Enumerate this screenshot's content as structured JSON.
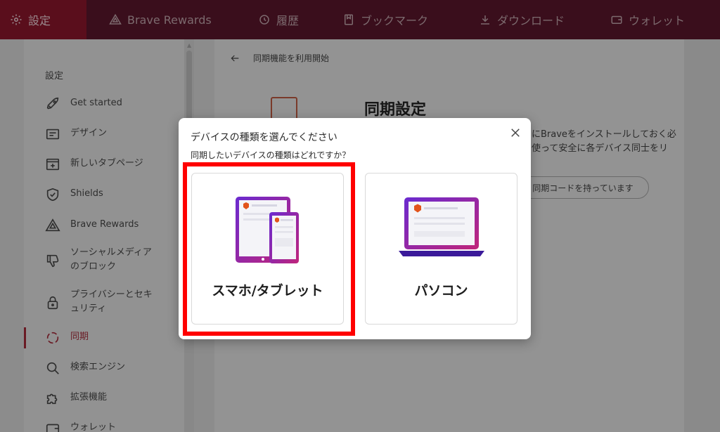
{
  "topnav": {
    "items": [
      {
        "label": "設定",
        "icon": "gear-icon",
        "active": true
      },
      {
        "label": "Brave Rewards",
        "icon": "triangle-icon",
        "active": false
      },
      {
        "label": "履歴",
        "icon": "history-icon",
        "active": false
      },
      {
        "label": "ブックマーク",
        "icon": "bookmark-icon",
        "active": false
      },
      {
        "label": "ダウンロード",
        "icon": "download-icon",
        "active": false
      },
      {
        "label": "ウォレット",
        "icon": "wallet-icon",
        "active": false
      }
    ]
  },
  "sidebar": {
    "title": "設定",
    "items": [
      {
        "label": "Get started",
        "icon": "rocket-icon"
      },
      {
        "label": "デザイン",
        "icon": "appearance-icon"
      },
      {
        "label": "新しいタブページ",
        "icon": "new-tab-icon"
      },
      {
        "label": "Shields",
        "icon": "shield-icon"
      },
      {
        "label": "Brave Rewards",
        "icon": "rewards-icon"
      },
      {
        "label": "ソーシャルメディアのブロック",
        "label_line1": "ソーシャルメディア",
        "label_line2": "のブロック",
        "icon": "thumbs-down-icon"
      },
      {
        "label": "プライバシーとセキュリティ",
        "label_line1": "プライバシーとセキ",
        "label_line2": "ュリティ",
        "icon": "lock-icon"
      },
      {
        "label": "同期",
        "icon": "sync-icon",
        "active": true
      },
      {
        "label": "検索エンジン",
        "icon": "search-icon"
      },
      {
        "label": "拡張機能",
        "icon": "puzzle-icon"
      },
      {
        "label": "ウォレット",
        "icon": "wallet-icon"
      }
    ]
  },
  "content": {
    "back_label": "同期機能を利用開始",
    "title": "同期設定",
    "desc_line1": "にBraveをインストールしておく必",
    "desc_line2": "使って安全に各デバイス同士をリ",
    "have_code_button": "同期コードを持っています"
  },
  "modal": {
    "title": "デバイスの種類を選んでください",
    "subtitle": "同期したいデバイスの種類はどれですか？",
    "options": [
      {
        "label": "スマホ/タブレット",
        "icon": "tablet-phone-icon"
      },
      {
        "label": "パソコン",
        "icon": "laptop-icon"
      }
    ]
  },
  "colors": {
    "highlight": "#ff0000",
    "accent": "#a8246a",
    "nav_bg": "#3a0e1c"
  }
}
